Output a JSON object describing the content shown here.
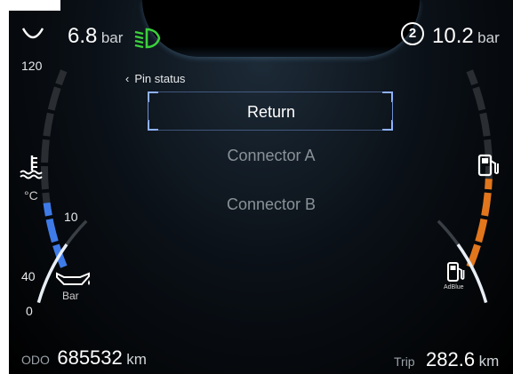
{
  "top_left_gauge": {
    "value": "6.8",
    "unit": "bar"
  },
  "top_right_gauge": {
    "badge": "2",
    "value": "10.2",
    "unit": "bar"
  },
  "headlight_icon": {
    "icon": "low-beam-headlight-icon",
    "color": "#3bd13b"
  },
  "left_gauge": {
    "top_label": "120",
    "temp_unit": "°C",
    "scale_mid": "10",
    "scale_low": "40",
    "scale_zero": "0",
    "oil_unit": "Bar",
    "temperature_fill_fraction": 0.33,
    "active_color": "#3f7be8"
  },
  "right_gauge": {
    "adblue_label": "AdBlue",
    "fuel_fill_fraction": 0.45,
    "active_color": "#e2761c"
  },
  "menu": {
    "breadcrumb": "Pin status",
    "items": [
      "Return",
      "Connector A",
      "Connector B"
    ],
    "selected_index": 0
  },
  "footer": {
    "odo_label": "ODO",
    "odo_value": "685532",
    "odo_unit": "km",
    "trip_label": "Trip",
    "trip_value": "282.6",
    "trip_unit": "km"
  }
}
